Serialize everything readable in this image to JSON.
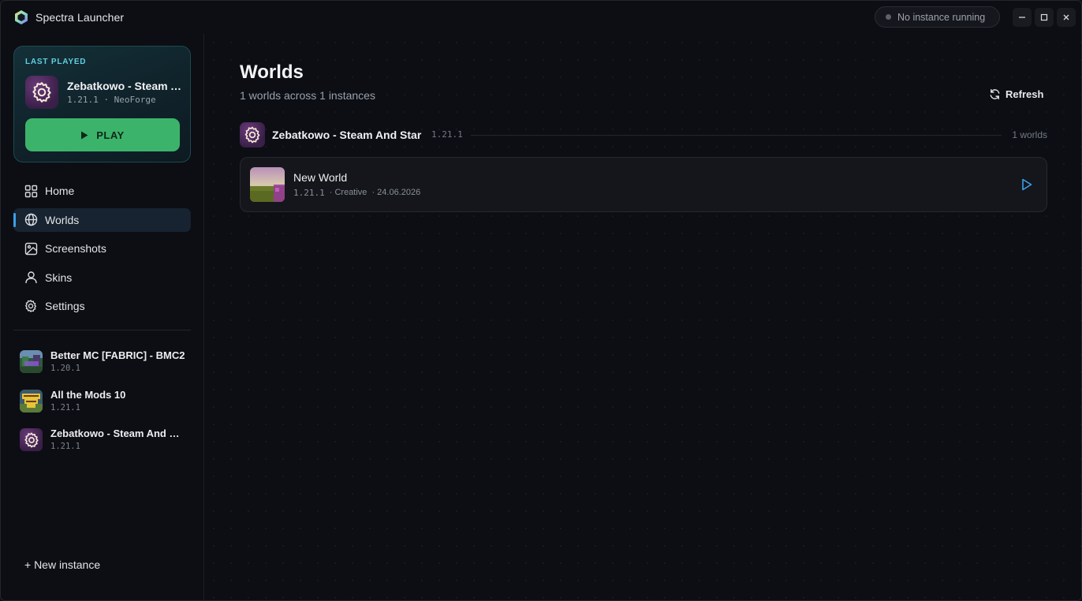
{
  "app": {
    "title": "Spectra Launcher",
    "status": "No instance running"
  },
  "sidebar": {
    "last_played": {
      "label": "LAST PLAYED",
      "name": "Zebatkowo - Steam And Star",
      "version": "1.21.1",
      "loader": "NeoForge",
      "play_label": "PLAY"
    },
    "nav": [
      {
        "label": "Home",
        "icon": "grid-icon"
      },
      {
        "label": "Worlds",
        "icon": "globe-icon",
        "active": true
      },
      {
        "label": "Screenshots",
        "icon": "image-icon"
      },
      {
        "label": "Skins",
        "icon": "user-icon"
      },
      {
        "label": "Settings",
        "icon": "gear-icon"
      }
    ],
    "instances": [
      {
        "name": "Better MC [FABRIC] - BMC2",
        "version": "1.20.1"
      },
      {
        "name": "All the Mods 10",
        "version": "1.21.1"
      },
      {
        "name": "Zebatkowo - Steam And Star",
        "version": "1.21.1"
      }
    ],
    "new_instance_label": "+ New instance"
  },
  "main": {
    "title": "Worlds",
    "subtitle": "1 worlds across 1 instances",
    "refresh_label": "Refresh",
    "groups": [
      {
        "instance_name": "Zebatkowo - Steam And Star",
        "version": "1.21.1",
        "count_label": "1 worlds",
        "worlds": [
          {
            "name": "New World",
            "version": "1.21.1",
            "mode": "· Creative",
            "date": "· 24.06.2026"
          }
        ]
      }
    ]
  },
  "colors": {
    "accent": "#3aa0e8",
    "play_green": "#3cb36b",
    "last_played_label": "#5fd0e0",
    "background": "#0c0e14"
  }
}
